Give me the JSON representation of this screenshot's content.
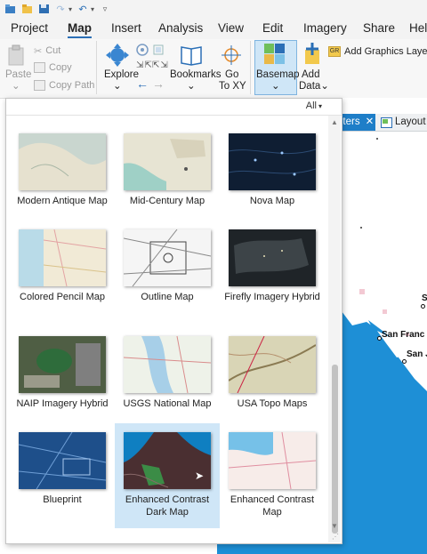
{
  "menu_tabs": [
    "Project",
    "Map",
    "Insert",
    "Analysis",
    "View",
    "Edit",
    "Imagery",
    "Share",
    "Hel"
  ],
  "active_tab": "Map",
  "ribbon": {
    "paste": "Paste",
    "cut": "Cut",
    "copy": "Copy",
    "copy_path": "Copy Path",
    "explore": "Explore",
    "bookmarks": "Bookmarks",
    "goto_line1": "Go",
    "goto_line2": "To XY",
    "basemap": "Basemap",
    "add_data_line1": "Add",
    "add_data_line2": "Data",
    "add_graphics_layer": "Add Graphics Layer",
    "group_suffix": "er"
  },
  "gallery": {
    "filter": "All",
    "items": [
      {
        "label": "Modern Antique Map"
      },
      {
        "label": "Mid-Century Map"
      },
      {
        "label": "Nova Map"
      },
      {
        "label": "Colored Pencil Map"
      },
      {
        "label": "Outline Map"
      },
      {
        "label": "Firefly Imagery Hybrid"
      },
      {
        "label": "NAIP Imagery Hybrid"
      },
      {
        "label": "USGS National Map"
      },
      {
        "label": "USA Topo Maps"
      },
      {
        "label": "Blueprint"
      },
      {
        "label": "Enhanced Contrast Dark Map"
      },
      {
        "label": "Enhanced Contrast Map"
      }
    ],
    "selected": "Enhanced Contrast Dark Map"
  },
  "map_view": {
    "tab_label": "eters",
    "layout_tab": "Layout",
    "labels": [
      "San Franc",
      "San J",
      "S"
    ]
  },
  "colors": {
    "accent": "#2b6fb6",
    "selected_bg": "#cfe6f7",
    "ocean": "#1e8fd6"
  }
}
